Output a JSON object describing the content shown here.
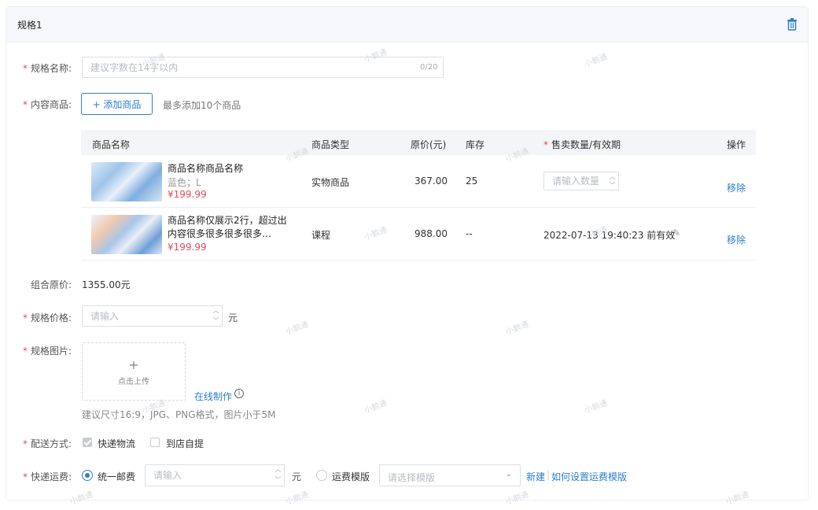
{
  "header": {
    "title": "规格1",
    "delete_icon": "trash-icon"
  },
  "form": {
    "name": {
      "label": "规格名称:",
      "placeholder": "建议字数在14字以内",
      "counter": "0/20"
    },
    "products": {
      "label": "内容商品:",
      "add_button": "+ 添加商品",
      "hint": "最多添加10个商品"
    },
    "table": {
      "headers": [
        "商品名称",
        "商品类型",
        "原价(元)",
        "库存",
        "售卖数量/有效期",
        "操作"
      ],
      "rows": [
        {
          "name": "商品名称商品名称",
          "spec": "蓝色；L",
          "price": "¥199.99",
          "type": "实物商品",
          "original_price": "367.00",
          "stock": "25",
          "qty_placeholder": "请输入数量",
          "action": "移除"
        },
        {
          "name": "商品名称仅展示2行，超过出内容很多很多很多很多…",
          "price": "¥199.99",
          "type": "课程",
          "original_price": "988.00",
          "stock": "--",
          "validity": "2022-07-13 19:40:23 前有效",
          "action": "移除"
        }
      ]
    },
    "combo_price": {
      "label": "组合原价:",
      "value": "1355.00元"
    },
    "spec_price": {
      "label": "规格价格:",
      "placeholder": "请输入",
      "unit": "元"
    },
    "spec_image": {
      "label": "规格图片:",
      "upload_plus": "+",
      "upload_text": "点击上传",
      "online_make": "在线制作",
      "hint": "建议尺寸16:9，JPG、PNG格式，图片小于5M"
    },
    "delivery": {
      "label": "配送方式:",
      "options": [
        {
          "label": "快递物流",
          "checked": true
        },
        {
          "label": "到店自提",
          "checked": false
        }
      ]
    },
    "shipping": {
      "label": "快递运费:",
      "unified": "统一邮费",
      "unified_placeholder": "请输入",
      "unit": "元",
      "template": "运费模版",
      "template_placeholder": "请选择模版",
      "new_link": "新建",
      "help_link": "如何设置运费模版"
    },
    "required_mark": "*"
  },
  "watermark": "小鹅通"
}
